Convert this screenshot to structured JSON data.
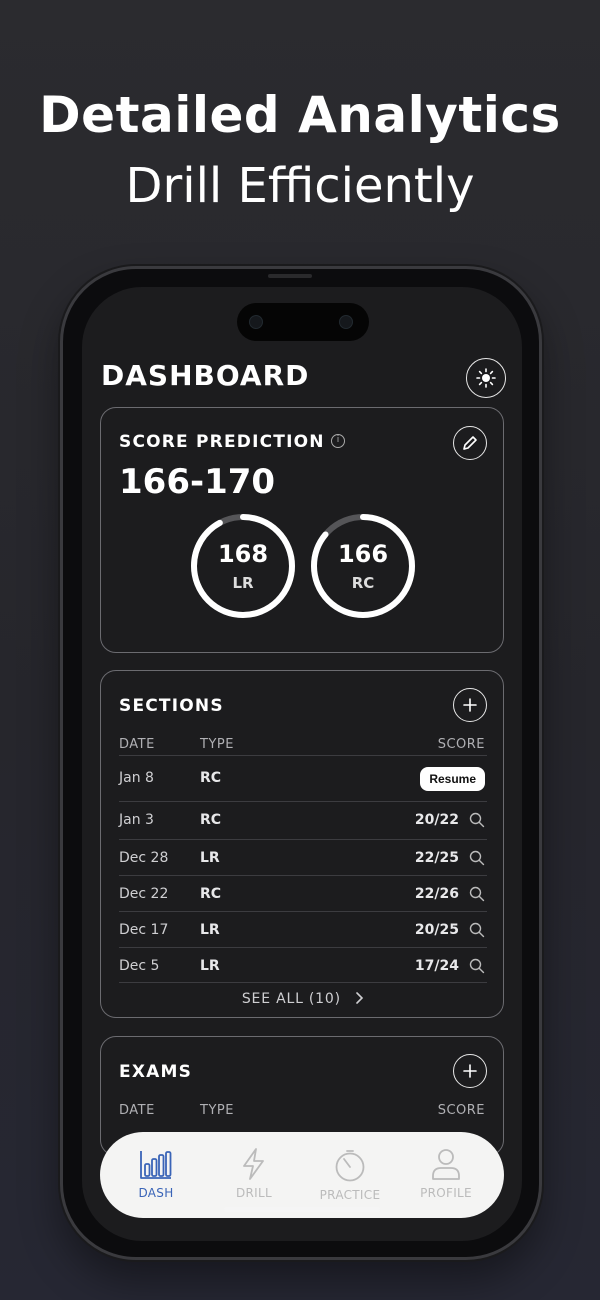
{
  "headline": {
    "line1": "Detailed Analytics",
    "line2": "Drill Efficiently"
  },
  "dashboard": {
    "title": "DASHBOARD",
    "theme_icon": "sun-icon",
    "score_prediction": {
      "label": "SCORE PREDICTION",
      "info_glyph": "i",
      "range": "166-170",
      "edit_icon": "pencil-icon",
      "rings": [
        {
          "value": "168",
          "label": "LR",
          "fill_fraction": 0.92
        },
        {
          "value": "166",
          "label": "RC",
          "fill_fraction": 0.86
        }
      ]
    },
    "sections": {
      "label": "SECTIONS",
      "add_icon": "plus-icon",
      "headers": {
        "date": "DATE",
        "type": "TYPE",
        "score": "SCORE"
      },
      "rows": [
        {
          "date": "Jan 8",
          "type": "RC",
          "score": "",
          "action": "Resume"
        },
        {
          "date": "Jan 3",
          "type": "RC",
          "score": "20/22"
        },
        {
          "date": "Dec 28",
          "type": "LR",
          "score": "22/25"
        },
        {
          "date": "Dec 22",
          "type": "RC",
          "score": "22/26"
        },
        {
          "date": "Dec 17",
          "type": "LR",
          "score": "20/25"
        },
        {
          "date": "Dec 5",
          "type": "LR",
          "score": "17/24"
        }
      ],
      "see_all": "SEE ALL (10)"
    },
    "exams": {
      "label": "EXAMS",
      "add_icon": "plus-icon",
      "headers": {
        "date": "DATE",
        "type": "TYPE",
        "score": "SCORE"
      }
    }
  },
  "tabbar": {
    "active_color": "#3a64b7",
    "tabs": [
      {
        "label": "DASH",
        "icon": "bar-chart-icon",
        "active": true
      },
      {
        "label": "DRILL",
        "icon": "lightning-icon",
        "active": false
      },
      {
        "label": "PRACTICE",
        "icon": "timer-icon",
        "active": false
      },
      {
        "label": "PROFILE",
        "icon": "person-icon",
        "active": false
      }
    ]
  }
}
